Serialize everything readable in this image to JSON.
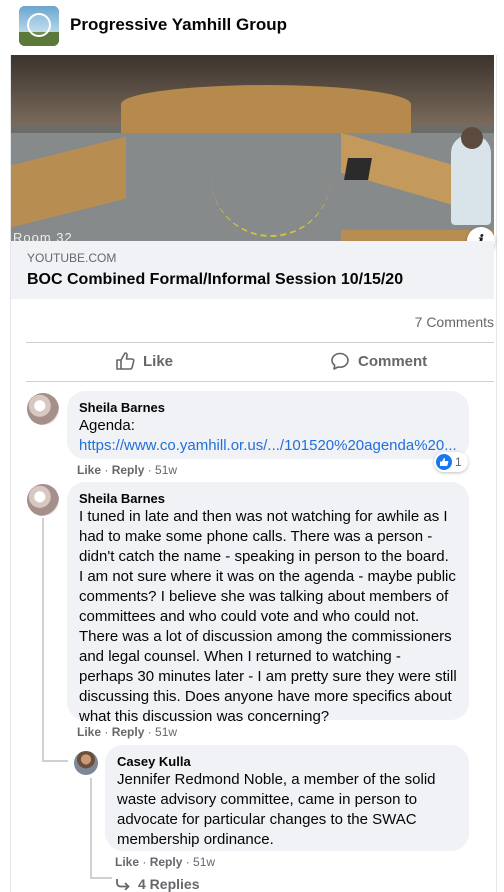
{
  "group": {
    "name": "Progressive Yamhill Group",
    "icon": "group-avatar-logo"
  },
  "post": {
    "video_overlay_text": "Room 32",
    "link_domain": "YOUTUBE.COM",
    "link_title": "BOC Combined Formal/Informal Session 10/15/20",
    "info_icon": "info-icon",
    "comment_count": "7 Comments",
    "actions": {
      "like_label": "Like",
      "comment_label": "Comment"
    }
  },
  "comments": [
    {
      "author": "Sheila Barnes",
      "text": "Agenda:",
      "link": "https://www.co.yamhill.or.us/.../101520%20agenda%20...",
      "like": "Like",
      "reply": "Reply",
      "time": "51w",
      "reaction_count": "1"
    },
    {
      "author": "Sheila Barnes",
      "text": "I tuned in late and then was not watching for awhile as I had to make some phone calls. There was a person - didn't catch the name - speaking in person to the board. I am not sure where it was on the agenda - maybe public comments? I believe she was talking about members of committees and who could vote and who could not. There was a lot of discussion among the commissioners and legal counsel. When I returned to watching - perhaps 30 minutes later - I am pretty sure they were still discussing this. Does anyone have more specifics about what this discussion was concerning?",
      "like": "Like",
      "reply": "Reply",
      "time": "51w"
    }
  ],
  "reply": {
    "author": "Casey Kulla",
    "text": "Jennifer Redmond Noble, a member of the solid waste advisory committee, came in person to advocate for particular changes to the SWAC membership ordinance.",
    "like": "Like",
    "reply": "Reply",
    "time": "51w"
  },
  "more_replies": "4 Replies",
  "colors": {
    "link": "#216fdb",
    "like_blue": "#1877f2",
    "bubble": "#f0f2f5",
    "muted": "#65676b"
  }
}
